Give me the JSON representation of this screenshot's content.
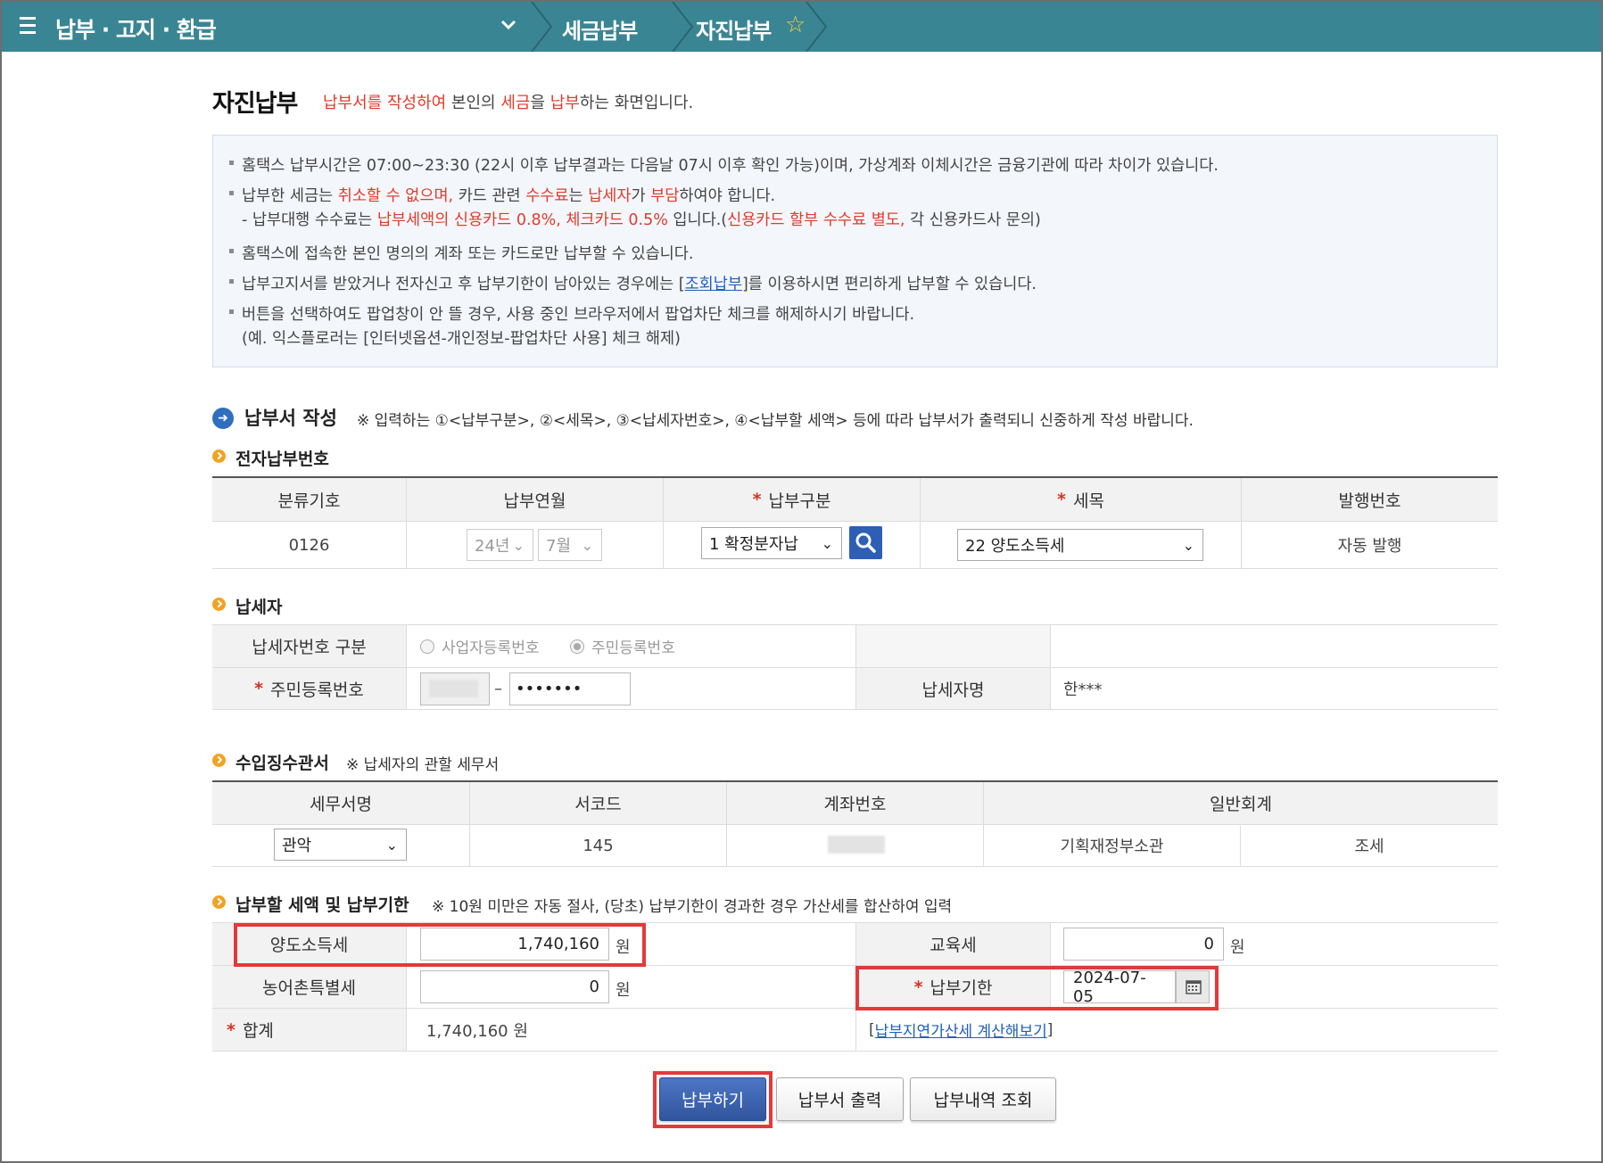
{
  "topbar": {
    "title": "납부 · 고지 · 환급",
    "crumbs": [
      "세금납부",
      "자진납부"
    ]
  },
  "heading": {
    "title": "자진납부",
    "desc_parts": [
      "납부서를 작성하여",
      " 본인의 ",
      "세금",
      "을 ",
      "납부",
      "하는 화면입니다."
    ]
  },
  "notice": {
    "line1": "홈택스 납부시간은 07:00~23:30 (22시 이후 납부결과는 다음날 07시 이후 확인 가능)이며, 가상계좌 이체시간은 금융기관에 따라 차이가 있습니다.",
    "line2": [
      "납부한 세금는 ",
      "취소할 수 없으며,",
      " 카드 관련 ",
      "수수료",
      "는 ",
      "납세자",
      "가 ",
      "부담",
      "하여야 합니다."
    ],
    "line3": [
      "- 납부대행 수수료는 ",
      "납부세액의 신용카드 0.8%, 체크카드 0.5%",
      " 입니다.(",
      "신용카드 할부 수수료 별도,",
      " 각 신용카드사 문의)"
    ],
    "line4": "홈택스에 접속한 본인 명의의 계좌 또는 카드로만 납부할 수 있습니다.",
    "line5": [
      "납부고지서를 받았거나 전자신고 후 납부기한이 남아있는 경우에는 [",
      "조회납부",
      "]를 이용하시면 편리하게  납부할 수 있습니다."
    ],
    "line6": "버튼을 선택하여도 팝업창이 안 뜰 경우, 사용 중인 브라우저에서 팝업차단 체크를 해제하시기 바랍니다.",
    "line7": "(예. 익스플로러는 [인터넷옵션-개인정보-팝업차단 사용] 체크 해제)"
  },
  "form": {
    "title": "납부서 작성",
    "note": "※ 입력하는 ①<납부구분>, ②<세목>, ③<납세자번호>, ④<납부할 세액> 등에 따라 납부서가 출력되니 신중하게 작성 바랍니다."
  },
  "epay": {
    "title": "전자납부번호",
    "headers": [
      "분류기호",
      "납부연월",
      "납부구분",
      "세목",
      "발행번호"
    ],
    "code": "0126",
    "year": "24년",
    "month": "7월",
    "pay_type": "1 확정분자납",
    "tax_item": "22 양도소득세",
    "issue_no": "자동 발행"
  },
  "taxpayer": {
    "title": "납세자",
    "id_type_label": "납세자번호 구분",
    "radio_biz": "사업자등록번호",
    "radio_rrn": "주민등록번호",
    "rrn_label": "주민등록번호",
    "rrn_back": "•••••••",
    "dash": "–",
    "name_label": "납세자명",
    "name_value": "한***"
  },
  "office": {
    "title": "수입징수관서",
    "note": "※ 납세자의 관할 세무서",
    "headers": [
      "세무서명",
      "서코드",
      "계좌번호",
      "일반회계"
    ],
    "office_name": "관악",
    "office_code": "145",
    "account_type": "기획재정부소관",
    "tax_kind": "조세"
  },
  "amount": {
    "title": "납부할 세액 및 납부기한",
    "note": "※ 10원 미만은 자동 절사, (당초) 납부기한이 경과한 경우 가산세를 합산하여 입력",
    "transfer_label": "양도소득세",
    "transfer_value": "1,740,160",
    "edu_label": "교육세",
    "edu_value": "0",
    "rural_label": "농어촌특별세",
    "rural_value": "0",
    "deadline_label": "납부기한",
    "deadline_value": "2024-07-05",
    "total_label": "합계",
    "total_value": "1,740,160  원",
    "unit": "원",
    "late_link": "납부지연가산세 계산해보기",
    "bracket_open": "[",
    "bracket_close": "]"
  },
  "buttons": {
    "pay": "납부하기",
    "print": "납부서 출력",
    "history": "납부내역 조회"
  },
  "colors": {
    "topbar": "#3a8593",
    "accent_red": "#e23b2c",
    "highlight": "#e4393a",
    "primary_button": "#30559e"
  }
}
